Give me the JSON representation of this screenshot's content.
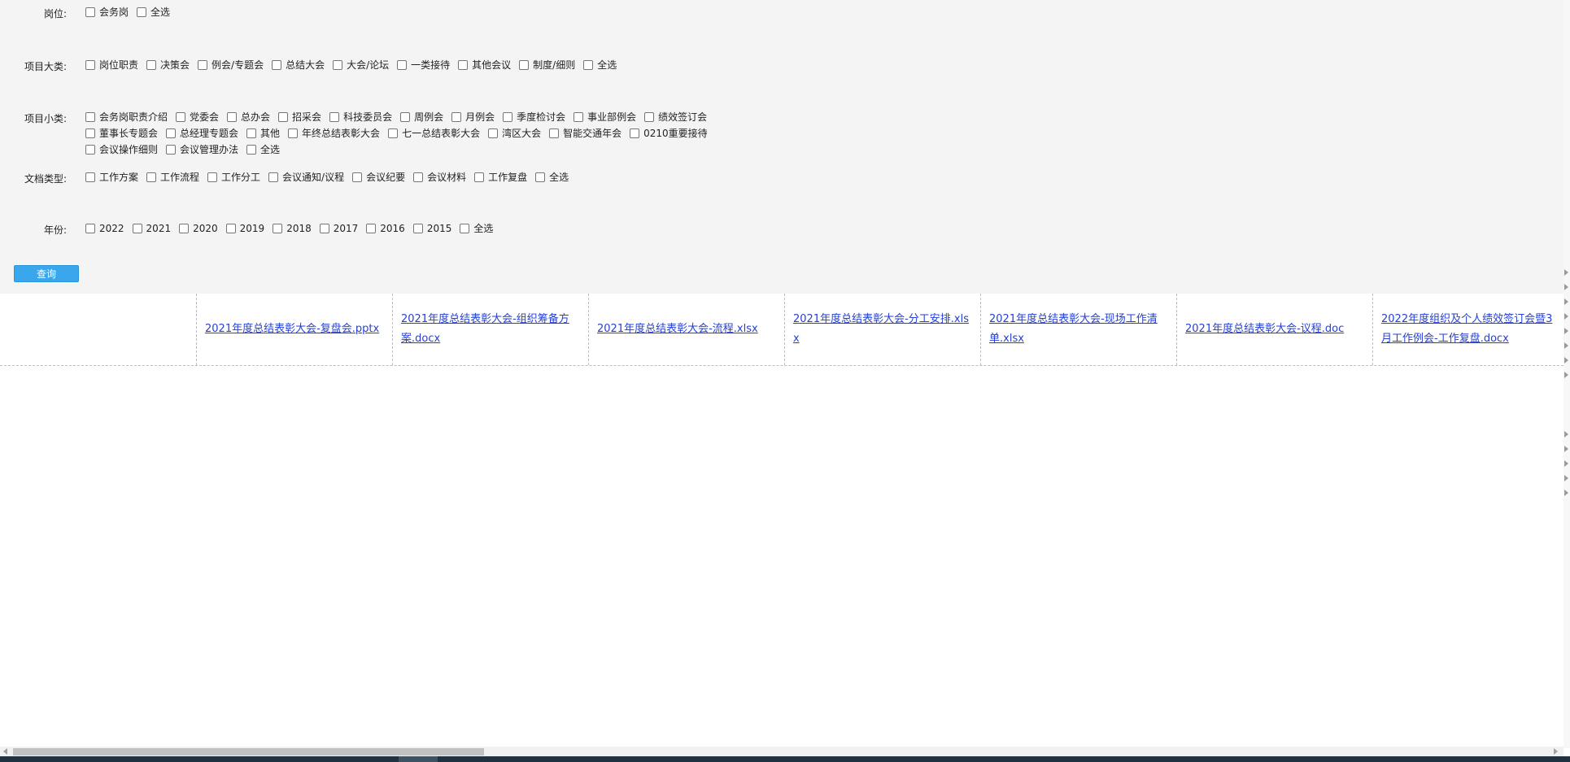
{
  "filters": {
    "position": {
      "label": "岗位:",
      "options": [
        "会务岗",
        "全选"
      ]
    },
    "category": {
      "label": "项目大类:",
      "options": [
        "岗位职责",
        "决策会",
        "例会/专题会",
        "总结大会",
        "大会/论坛",
        "一类接待",
        "其他会议",
        "制度/细则",
        "全选"
      ]
    },
    "subcategory": {
      "label": "项目小类:",
      "options_line1": [
        "会务岗职责介绍",
        "党委会",
        "总办会",
        "招采会",
        "科技委员会",
        "周例会",
        "月例会",
        "季度检讨会",
        "事业部例会",
        "绩效签订会"
      ],
      "options_line2": [
        "董事长专题会",
        "总经理专题会",
        "其他",
        "年终总结表彰大会",
        "七一总结表彰大会",
        "湾区大会",
        "智能交通年会",
        "0210重要接待"
      ],
      "options_line3": [
        "会议操作细则",
        "会议管理办法",
        "全选"
      ]
    },
    "doctype": {
      "label": "文档类型:",
      "options": [
        "工作方案",
        "工作流程",
        "工作分工",
        "会议通知/议程",
        "会议纪要",
        "会议材料",
        "工作复盘",
        "全选"
      ]
    },
    "year": {
      "label": "年份:",
      "options": [
        "2022",
        "2021",
        "2020",
        "2019",
        "2018",
        "2017",
        "2016",
        "2015",
        "全选"
      ]
    }
  },
  "query_button": "查询",
  "results": [
    "",
    "2021年度总结表彰大会-复盘会.pptx",
    "2021年度总结表彰大会-组织筹备方案.docx",
    "2021年度总结表彰大会-流程.xlsx",
    "2021年度总结表彰大会-分工安排.xlsx",
    "2021年度总结表彰大会-现场工作清单.xlsx",
    "2021年度总结表彰大会-议程.doc",
    "2022年度组织及个人绩效签订会暨3月工作例会-工作复盘.docx"
  ],
  "colors": {
    "accent": "#3aa6ec",
    "link": "#2440d6",
    "panel_bg": "#f4f4f4"
  }
}
